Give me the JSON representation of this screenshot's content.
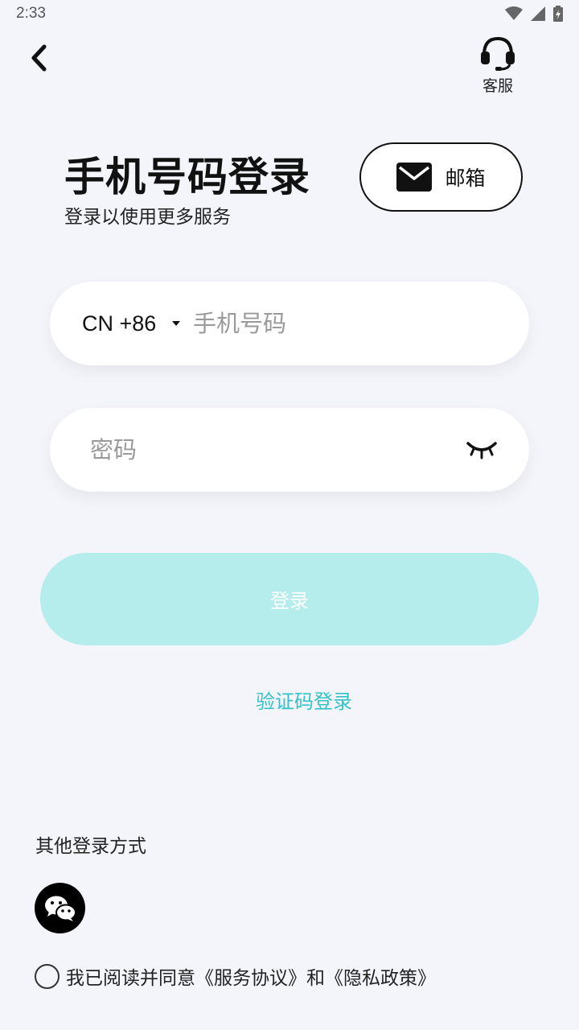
{
  "status_bar": {
    "time": "2:33",
    "icons": [
      "wifi-icon",
      "signal-icon",
      "battery-icon"
    ]
  },
  "header": {
    "back_icon": "chevron-left-icon",
    "service_label": "客服",
    "service_icon": "headset-icon"
  },
  "title": {
    "main": "手机号码登录",
    "subtitle": "登录以使用更多服务"
  },
  "email_switch": {
    "label": "邮箱",
    "icon": "mail-icon"
  },
  "form": {
    "country_code": "CN +86",
    "phone_placeholder": "手机号码",
    "password_placeholder": "密码",
    "eye_icon": "eye-closed-icon",
    "login_label": "登录",
    "code_login_label": "验证码登录"
  },
  "other_login": {
    "title": "其他登录方式",
    "wechat_icon": "wechat-icon"
  },
  "agreement": {
    "text": "我已阅读并同意《服务协议》和《隐私政策》"
  },
  "colors": {
    "background": "#f4f5fa",
    "login_button": "#b5ecec",
    "link": "#33c2c6"
  }
}
